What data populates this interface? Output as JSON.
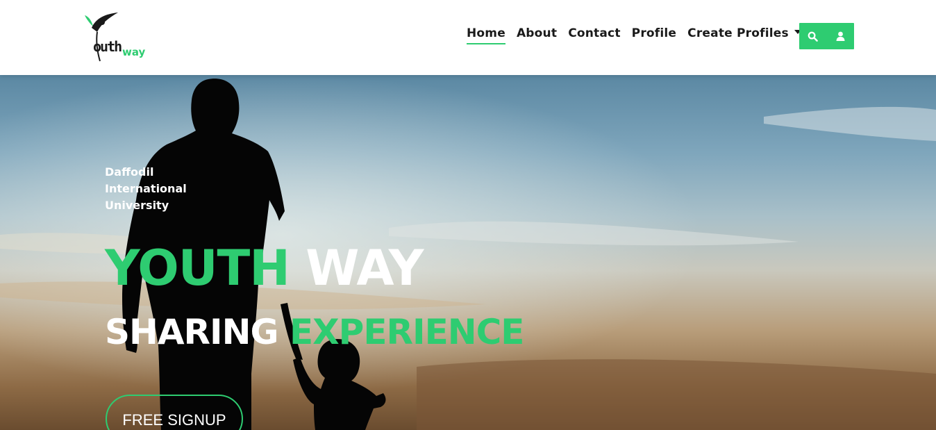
{
  "brand": {
    "logo_text_main": "Youth",
    "logo_text_accent": "way",
    "accent_color": "#2ecc71"
  },
  "nav": {
    "items": [
      {
        "label": "Home",
        "active": true
      },
      {
        "label": "About",
        "active": false
      },
      {
        "label": "Contact",
        "active": false
      },
      {
        "label": "Profile",
        "active": false
      },
      {
        "label": "Create Profiles",
        "active": false,
        "dropdown": true
      }
    ],
    "search_icon": "search-icon",
    "user_icon": "user-icon"
  },
  "hero": {
    "university_lines": [
      "Daffodil",
      "International",
      "University"
    ],
    "title_green": "YOUTH",
    "title_white": "WAY",
    "subtitle_white": "SHARING",
    "subtitle_green": "EXPERIENCE",
    "cta_label": "FREE SIGNUP"
  }
}
